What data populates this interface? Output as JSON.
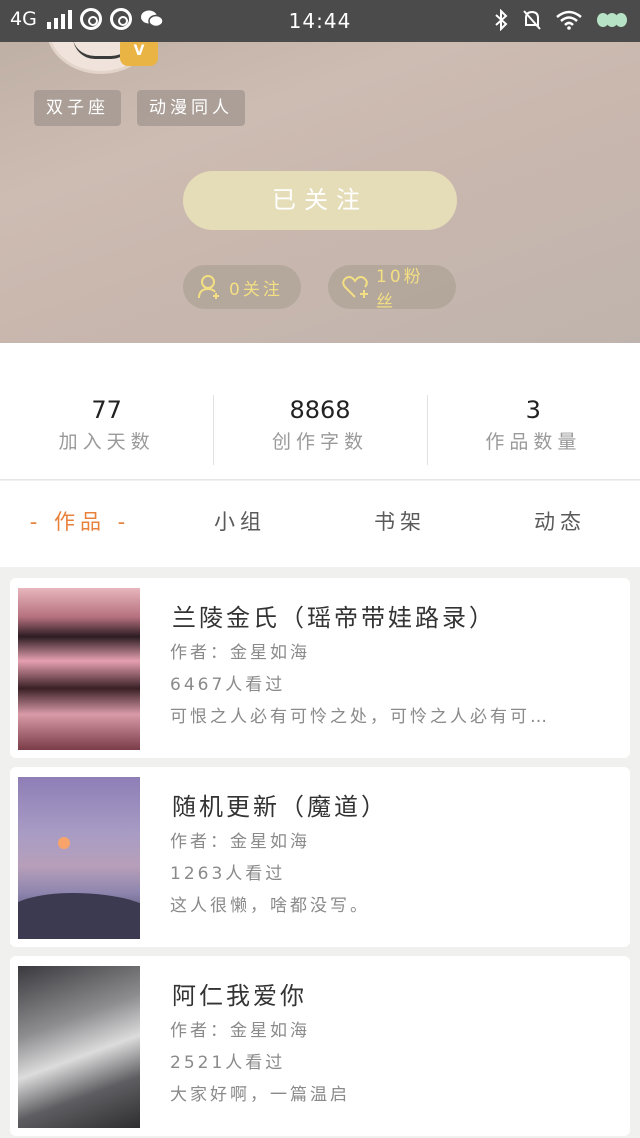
{
  "status_bar": {
    "network": "4G",
    "time": "14:44"
  },
  "profile": {
    "vip_badge": "V",
    "tags": [
      "双子座",
      "动漫同人"
    ],
    "follow_button": "已关注",
    "following": "0关注",
    "fans": "10粉丝"
  },
  "stats": [
    {
      "value": "77",
      "label": "加入天数"
    },
    {
      "value": "8868",
      "label": "创作字数"
    },
    {
      "value": "3",
      "label": "作品数量"
    }
  ],
  "tabs": [
    "- 作品 -",
    "小组",
    "书架",
    "动态"
  ],
  "works": [
    {
      "title": "兰陵金氏（瑶帝带娃路录）",
      "author": "作者：金星如海",
      "views": "6467人看过",
      "desc": "可恨之人必有可怜之处，可怜之人必有可…"
    },
    {
      "title": "随机更新（魔道）",
      "author": "作者：金星如海",
      "views": "1263人看过",
      "desc": "这人很懒，啥都没写。"
    },
    {
      "title": "阿仁我爱你",
      "author": "作者：金星如海",
      "views": "2521人看过",
      "desc": "大家好啊，一篇温启"
    }
  ],
  "colors": {
    "accent": "#e8813c",
    "follow_bg": "#e5dcb8",
    "pill_text": "#f3df83"
  }
}
